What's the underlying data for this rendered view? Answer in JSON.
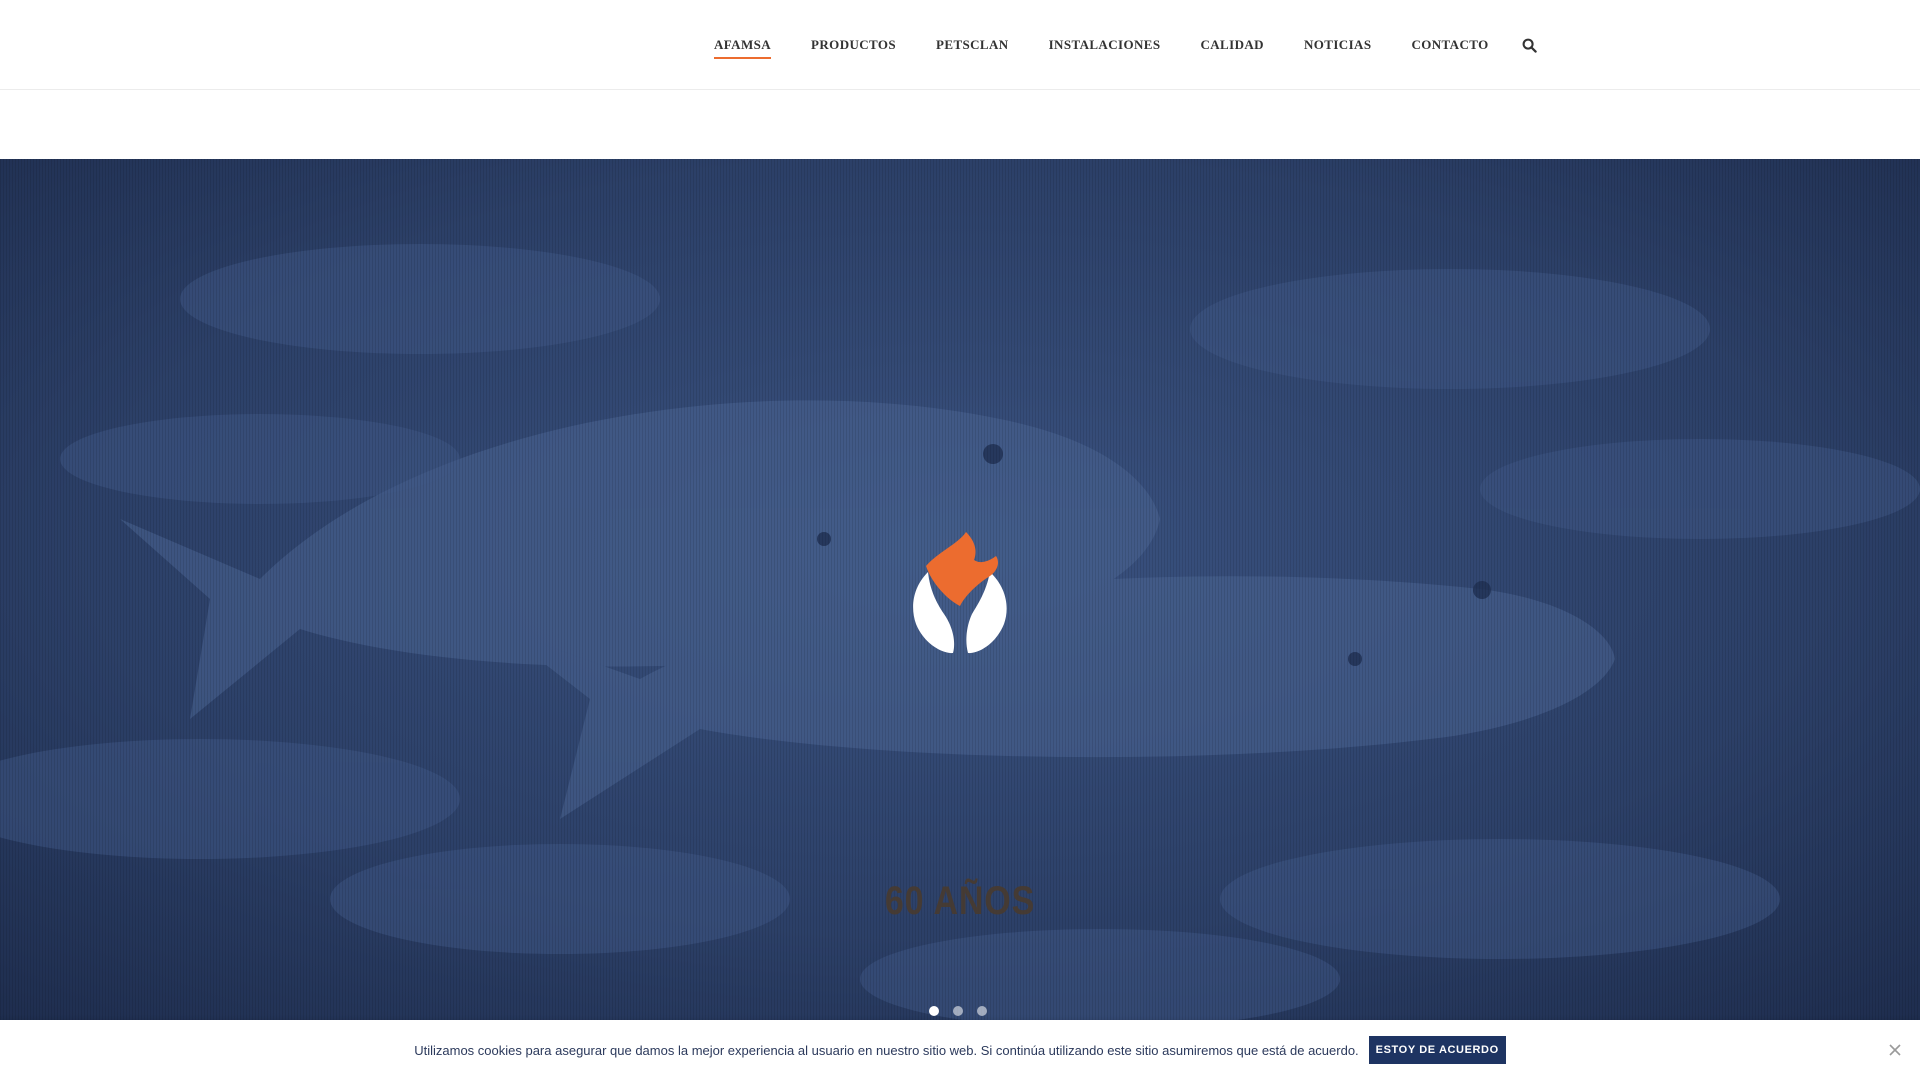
{
  "nav": {
    "items": [
      {
        "label": "AFAMSA",
        "active": true
      },
      {
        "label": "PRODUCTOS",
        "active": false
      },
      {
        "label": "PETSCLAN",
        "active": false
      },
      {
        "label": "INSTALACIONES",
        "active": false
      },
      {
        "label": "CALIDAD",
        "active": false
      },
      {
        "label": "NOTICIAS",
        "active": false
      },
      {
        "label": "CONTACTO",
        "active": false
      }
    ],
    "search_icon": "search-icon"
  },
  "hero": {
    "heading": "60 AÑOS",
    "logo": "afamsa-logo",
    "slides_total": 3,
    "active_slide": 1
  },
  "cookie": {
    "text": "Utilizamos cookies para asegurar que damos la mejor experiencia al usuario en nuestro sitio web. Si continúa utilizando este sitio asumiremos que está de acuerdo.",
    "accept_label": "ESTOY DE ACUERDO",
    "close_icon": "close-icon"
  },
  "colors": {
    "accent": "#ec6c2f",
    "hero_blue": "#2a3d63",
    "button_blue": "#1e3462"
  }
}
